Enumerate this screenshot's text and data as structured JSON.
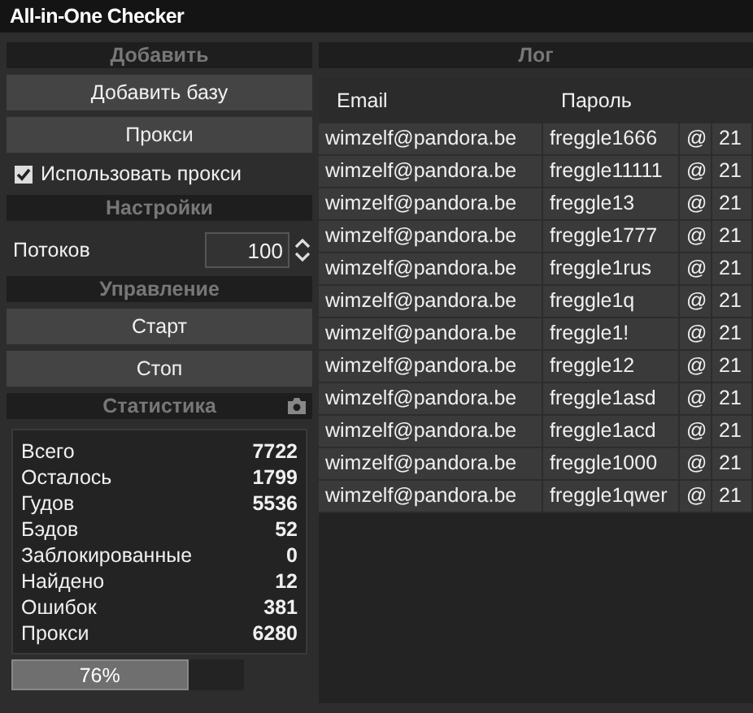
{
  "window": {
    "title": "All-in-One Checker"
  },
  "sidebar": {
    "add_header": "Добавить",
    "add_base_button": "Добавить базу",
    "proxy_button": "Прокси",
    "use_proxy": {
      "label": "Использовать прокси",
      "checked": true
    },
    "settings_header": "Настройки",
    "threads": {
      "label": "Потоков",
      "value": "100"
    },
    "control_header": "Управление",
    "start_button": "Старт",
    "stop_button": "Стоп",
    "stats_header": "Статистика",
    "stats": [
      {
        "label": "Всего",
        "value": "7722"
      },
      {
        "label": "Осталось",
        "value": "1799"
      },
      {
        "label": "Гудов",
        "value": "5536"
      },
      {
        "label": "Бэдов",
        "value": "52"
      },
      {
        "label": "Заблокированные",
        "value": "0"
      },
      {
        "label": "Найдено",
        "value": "12"
      },
      {
        "label": "Ошибок",
        "value": "381"
      },
      {
        "label": "Прокси",
        "value": "6280"
      }
    ],
    "progress": {
      "level": 0.76,
      "text": "76%"
    }
  },
  "log": {
    "header": "Лог",
    "table": {
      "columns": [
        "Email",
        "Пароль"
      ],
      "rows": [
        [
          "wimzelf@pandora.be",
          "freggle1666",
          "@",
          "21"
        ],
        [
          "wimzelf@pandora.be",
          "freggle11111",
          "@",
          "21"
        ],
        [
          "wimzelf@pandora.be",
          "freggle13",
          "@",
          "21"
        ],
        [
          "wimzelf@pandora.be",
          "freggle1777",
          "@",
          "21"
        ],
        [
          "wimzelf@pandora.be",
          "freggle1rus",
          "@",
          "21"
        ],
        [
          "wimzelf@pandora.be",
          "freggle1q",
          "@",
          "21"
        ],
        [
          "wimzelf@pandora.be",
          "freggle1!",
          "@",
          "21"
        ],
        [
          "wimzelf@pandora.be",
          "freggle12",
          "@",
          "21"
        ],
        [
          "wimzelf@pandora.be",
          "freggle1asd",
          "@",
          "21"
        ],
        [
          "wimzelf@pandora.be",
          "freggle1acd",
          "@",
          "21"
        ],
        [
          "wimzelf@pandora.be",
          "freggle1000",
          "@",
          "21"
        ],
        [
          "wimzelf@pandora.be",
          "freggle1qwer",
          "@",
          "21"
        ]
      ]
    }
  }
}
